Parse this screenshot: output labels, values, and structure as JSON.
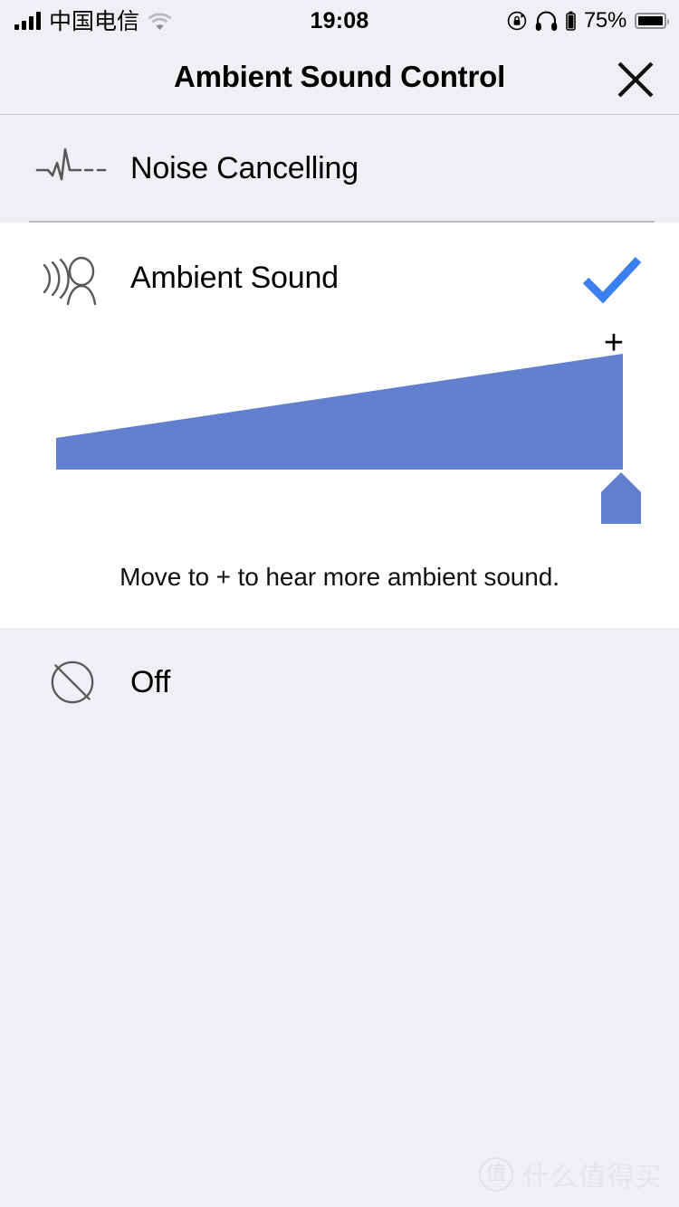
{
  "status_bar": {
    "carrier": "中国电信",
    "signal_bars": 4,
    "wifi_icon": "wifi-icon",
    "time": "19:08",
    "rotation_lock_icon": "rotation-lock-icon",
    "headphones_icon": "headphones-icon",
    "headphone_battery_icon": "headphone-battery-icon",
    "battery_percent": "75%",
    "battery_icon": "battery-icon"
  },
  "header": {
    "title": "Ambient Sound Control",
    "close_icon": "close-icon"
  },
  "options": [
    {
      "id": "noise-cancelling",
      "label": "Noise Cancelling",
      "icon": "noise-cancelling-waveform-icon",
      "selected": false
    },
    {
      "id": "ambient-sound",
      "label": "Ambient Sound",
      "icon": "ambient-sound-person-icon",
      "selected": true,
      "check_icon": "check-icon"
    },
    {
      "id": "off",
      "label": "Off",
      "icon": "off-slashed-circle-icon",
      "selected": false
    }
  ],
  "slider": {
    "plus_label": "+",
    "hint": "Move to + to hear more ambient sound.",
    "value": 20,
    "min": 0,
    "max": 20,
    "thumb_icon": "slider-thumb-pentagon",
    "track_icon": "ambient-level-wedge"
  },
  "colors": {
    "accent_blue": "#3b7ff0",
    "slider_blue": "#6280cf",
    "background": "#efeff4",
    "panel": "#ffffff",
    "divider": "#c8c7cc",
    "icon_gray": "#595959"
  },
  "watermark": {
    "logo_glyph": "值",
    "text": "什么值得买"
  }
}
